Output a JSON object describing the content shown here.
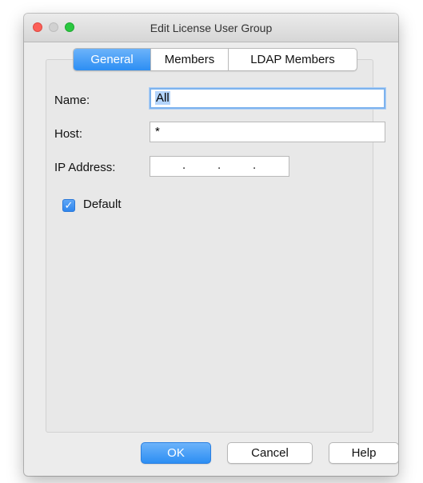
{
  "window": {
    "title": "Edit License User Group"
  },
  "tabs": [
    {
      "label": "General",
      "active": true
    },
    {
      "label": "Members",
      "active": false
    },
    {
      "label": "LDAP Members",
      "active": false
    }
  ],
  "form": {
    "name_label": "Name:",
    "name_value": "All",
    "host_label": "Host:",
    "host_value": "*",
    "ip_label": "IP Address:",
    "ip_dots": [
      ".",
      ".",
      "."
    ],
    "default_label": "Default",
    "default_checked": true
  },
  "buttons": {
    "ok": "OK",
    "cancel": "Cancel",
    "help": "Help"
  },
  "colors": {
    "accent": "#2c8ef3",
    "close": "#fc5f57",
    "minimize": "#d1d1d1",
    "maximize": "#2ac840"
  }
}
